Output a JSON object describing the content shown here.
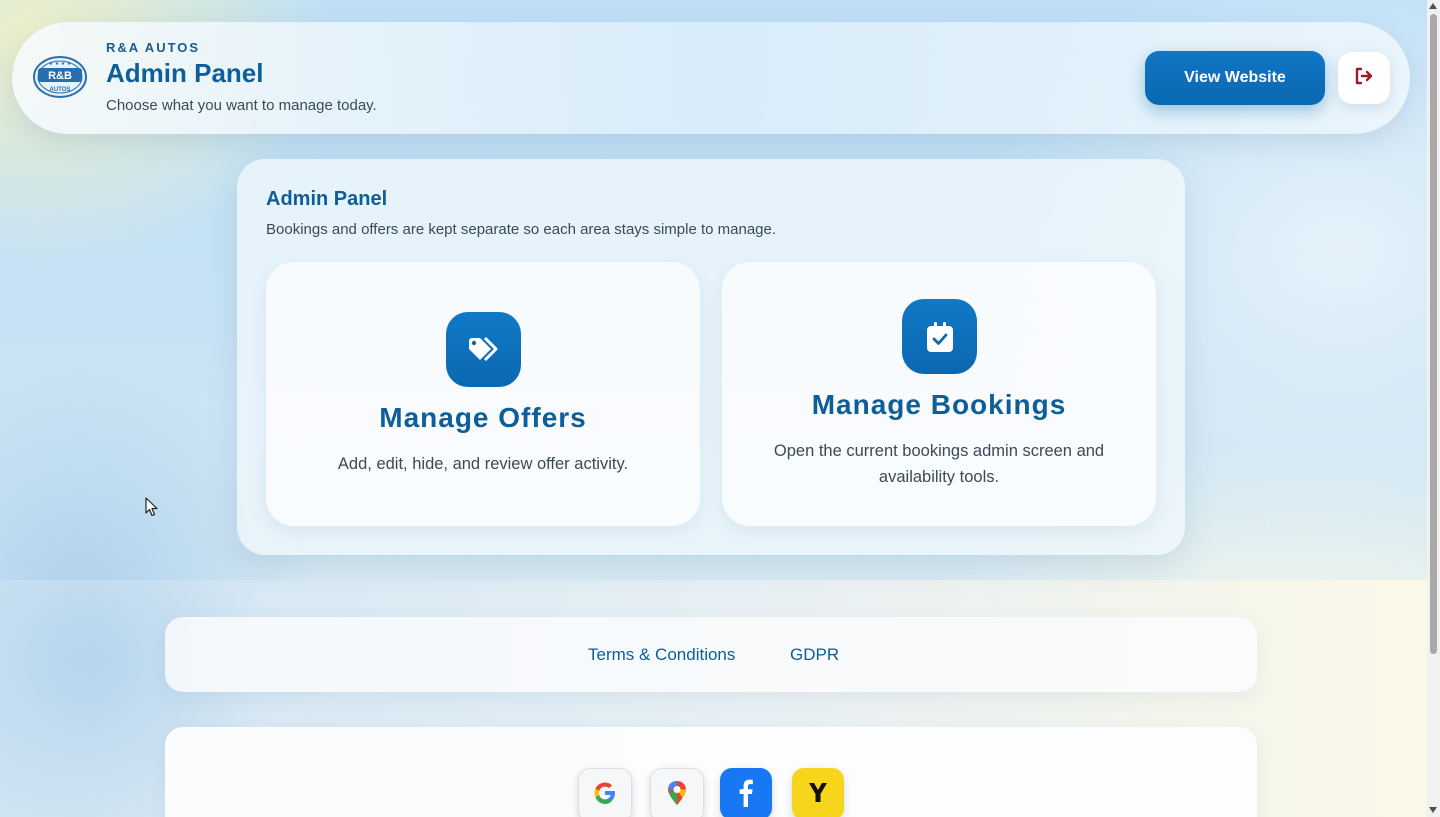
{
  "header": {
    "brand": "R&A AUTOS",
    "title": "Admin Panel",
    "subtitle": "Choose what you want to manage today.",
    "logo_text": "R&B AUTOS",
    "view_website_label": "View Website",
    "logout_icon": "logout-icon"
  },
  "panel": {
    "title": "Admin Panel",
    "description": "Bookings and offers are kept separate so each area stays simple to manage.",
    "cards": [
      {
        "icon": "tags-icon",
        "title": "Manage Offers",
        "description": "Add, edit, hide, and review offer activity."
      },
      {
        "icon": "calendar-check-icon",
        "title": "Manage Bookings",
        "description": "Open the current bookings admin screen and availability tools."
      }
    ]
  },
  "footer": {
    "links": [
      "Terms & Conditions",
      "GDPR"
    ],
    "social": [
      {
        "name": "google",
        "glyph": "G"
      },
      {
        "name": "google-maps",
        "glyph": ""
      },
      {
        "name": "facebook",
        "glyph": "f"
      },
      {
        "name": "yelp",
        "glyph": "Y"
      }
    ]
  },
  "colors": {
    "primary": "#0a68b2",
    "title": "#0d5e99",
    "text": "#3a4a58",
    "logout": "#9b1c2c",
    "facebook": "#1877f2",
    "yelp": "#f7d51d"
  }
}
